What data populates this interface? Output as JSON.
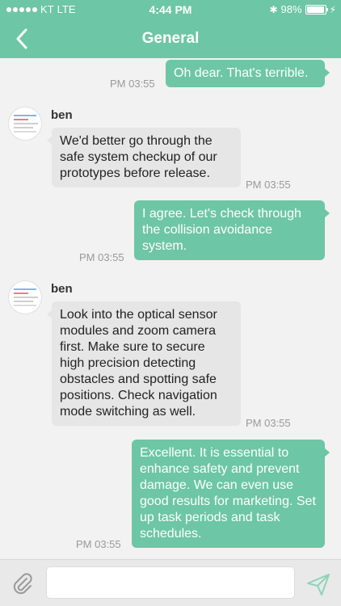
{
  "status_bar": {
    "carrier": "KT",
    "network": "LTE",
    "time": "4:44 PM",
    "battery": "98%",
    "battery_level": 0.98
  },
  "header": {
    "title": "General",
    "back_icon": "chevron-left-icon"
  },
  "messages": [
    {
      "direction": "out",
      "text": "Oh dear. That's terrible.",
      "time": "PM 03:55"
    },
    {
      "direction": "in",
      "sender": "ben",
      "text": "We'd better go through the safe system checkup of our prototypes before release.",
      "time": "PM 03:55"
    },
    {
      "direction": "out",
      "text": "I agree. Let's check through the collision avoidance system.",
      "time": "PM 03:55"
    },
    {
      "direction": "in",
      "sender": "ben",
      "text": "Look into the optical sensor modules and zoom camera first. Make sure to secure high precision detecting obstacles and spotting safe positions. Check navigation mode switching as well.",
      "time": "PM 03:55"
    },
    {
      "direction": "out",
      "text": "Excellent. It is essential to enhance safety and prevent damage. We can even use good results for marketing. Set up task periods and task schedules.",
      "time": "PM 03:55"
    }
  ],
  "composer": {
    "attach_icon": "paperclip-icon",
    "input_value": "",
    "send_icon": "send-icon"
  },
  "colors": {
    "accent": "#6dc6a6",
    "incoming_bubble": "#e6e6e6",
    "timestamp": "#999999"
  }
}
